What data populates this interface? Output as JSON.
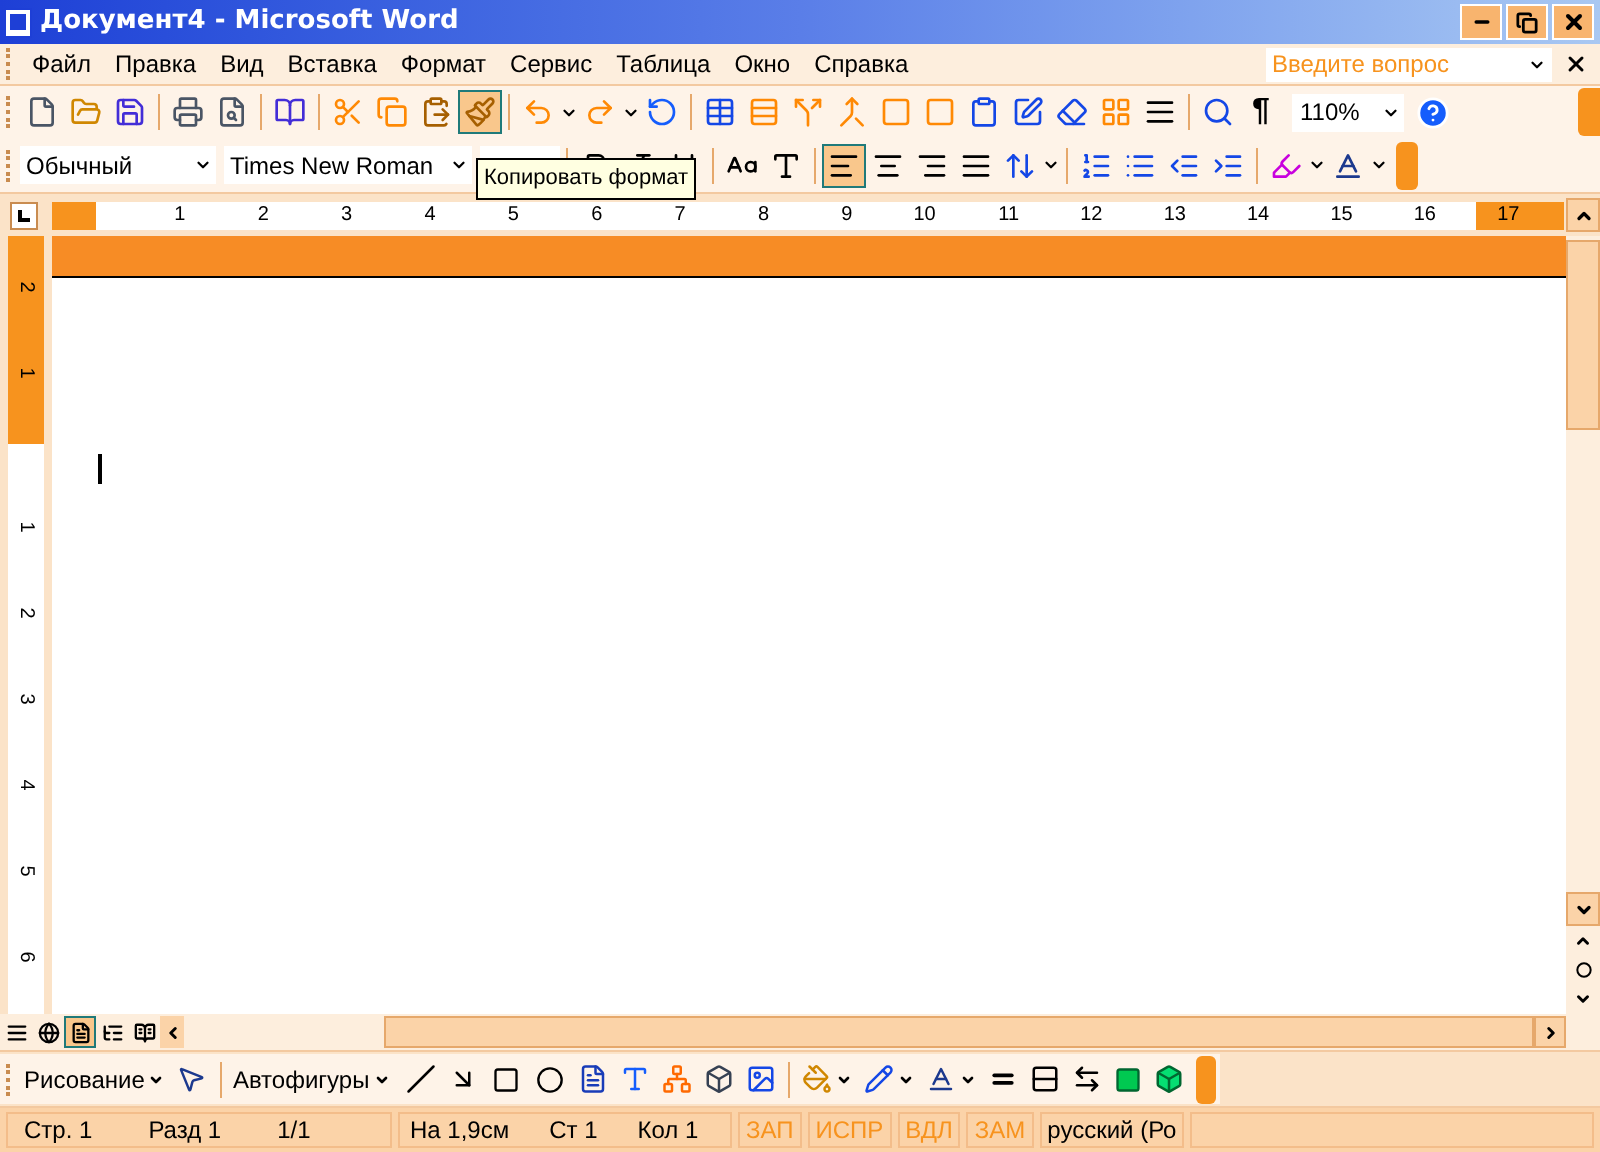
{
  "window": {
    "title": "Документ4 - Microsoft Word"
  },
  "menu": {
    "items": [
      "Файл",
      "Правка",
      "Вид",
      "Вставка",
      "Формат",
      "Сервис",
      "Таблица",
      "Окно",
      "Справка"
    ],
    "help_placeholder": "Введите вопрос"
  },
  "standard_toolbar": {
    "groups": [
      [
        {
          "kind": "new",
          "selected": false
        },
        {
          "kind": "open",
          "selected": false
        },
        {
          "kind": "save",
          "selected": false
        }
      ],
      [
        {
          "kind": "print",
          "selected": false
        },
        {
          "kind": "preview",
          "selected": false
        }
      ],
      [
        {
          "kind": "research",
          "selected": false
        }
      ],
      [
        {
          "kind": "cut",
          "selected": false
        },
        {
          "kind": "copy",
          "selected": false
        },
        {
          "kind": "paste",
          "selected": false
        },
        {
          "kind": "painter",
          "selected": true
        }
      ],
      [
        {
          "kind": "undo",
          "selected": false
        },
        {
          "kind": "redo",
          "selected": false
        },
        {
          "kind": "refresh",
          "selected": false
        }
      ],
      [
        {
          "kind": "table",
          "selected": false
        },
        {
          "kind": "rows",
          "selected": false
        },
        {
          "kind": "split",
          "selected": false
        },
        {
          "kind": "merge",
          "selected": false
        },
        {
          "kind": "frame",
          "selected": false
        },
        {
          "kind": "frame",
          "selected": false
        },
        {
          "kind": "clipboard",
          "selected": false
        },
        {
          "kind": "edit-table",
          "selected": false
        },
        {
          "kind": "erase-table",
          "selected": false
        },
        {
          "kind": "grid",
          "selected": false
        },
        {
          "kind": "lines",
          "selected": false
        }
      ],
      [
        {
          "kind": "docmap",
          "selected": false
        }
      ]
    ],
    "pilcrow": "¶",
    "zoom": "110%"
  },
  "formatting_toolbar": {
    "style": "Обычный",
    "font": "Times New Roman",
    "groups": [
      [
        {
          "kind": "bold",
          "selected": false
        },
        {
          "kind": "italic",
          "selected": false
        },
        {
          "kind": "underline",
          "selected": false
        }
      ],
      [
        {
          "kind": "grow",
          "selected": false
        },
        {
          "kind": "shrink",
          "selected": false
        }
      ],
      [
        {
          "kind": "align-left",
          "selected": true
        },
        {
          "kind": "align-center",
          "selected": false
        },
        {
          "kind": "align-right",
          "selected": false
        },
        {
          "kind": "justify",
          "selected": false
        },
        {
          "kind": "spacing",
          "selected": false
        }
      ],
      [
        {
          "kind": "numbering",
          "selected": false
        },
        {
          "kind": "bullets",
          "selected": false
        },
        {
          "kind": "outdent",
          "selected": false
        },
        {
          "kind": "indent",
          "selected": false
        }
      ],
      [
        {
          "kind": "highlight",
          "selected": false
        },
        {
          "kind": "font-color",
          "selected": false
        }
      ]
    ]
  },
  "tooltip": "Копировать формат",
  "ruler": {
    "numbers": [
      "1",
      "2",
      "3",
      "4",
      "5",
      "6",
      "7",
      "8",
      "9",
      "10",
      "11",
      "12",
      "13",
      "14",
      "15",
      "16",
      "17"
    ],
    "vertical_numbers": [
      "2",
      "1",
      "1",
      "2",
      "3",
      "4",
      "5",
      "6"
    ]
  },
  "views": [
    {
      "kind": "normal",
      "selected": false
    },
    {
      "kind": "web",
      "selected": false
    },
    {
      "kind": "print",
      "selected": true
    },
    {
      "kind": "outline",
      "selected": false
    },
    {
      "kind": "reading",
      "selected": false
    }
  ],
  "drawing_toolbar": {
    "drawing_menu": "Рисование",
    "autoshapes": "Автофигуры"
  },
  "status_bar": {
    "fields": [
      "Стр. 1",
      "Разд 1",
      "1/1",
      "На 1,9см",
      "Ст 1",
      "Кол 1"
    ],
    "modes": [
      {
        "label": "ЗАП",
        "disabled": true
      },
      {
        "label": "ИСПР",
        "disabled": true
      },
      {
        "label": "ВДЛ",
        "disabled": true
      },
      {
        "label": "ЗАМ",
        "disabled": true
      }
    ],
    "language": "русский (Ро"
  }
}
